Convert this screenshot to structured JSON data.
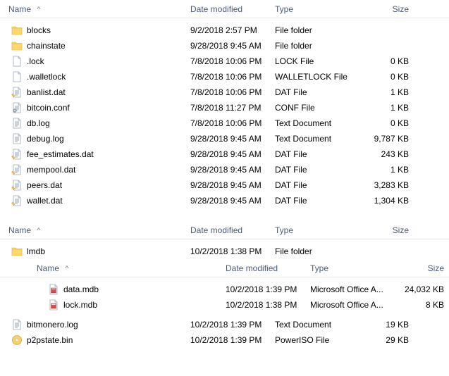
{
  "headers": {
    "name": "Name",
    "date": "Date modified",
    "type": "Type",
    "size": "Size"
  },
  "panel1": {
    "rows": [
      {
        "icon": "folder",
        "name": "blocks",
        "date": "9/2/2018 2:57 PM",
        "type": "File folder",
        "size": ""
      },
      {
        "icon": "folder",
        "name": "chainstate",
        "date": "9/28/2018 9:45 AM",
        "type": "File folder",
        "size": ""
      },
      {
        "icon": "file",
        "name": ".lock",
        "date": "7/8/2018 10:06 PM",
        "type": "LOCK File",
        "size": "0 KB"
      },
      {
        "icon": "file",
        "name": ".walletlock",
        "date": "7/8/2018 10:06 PM",
        "type": "WALLETLOCK File",
        "size": "0 KB"
      },
      {
        "icon": "dat",
        "name": "banlist.dat",
        "date": "7/8/2018 10:06 PM",
        "type": "DAT File",
        "size": "1 KB"
      },
      {
        "icon": "conf",
        "name": "bitcoin.conf",
        "date": "7/8/2018 11:27 PM",
        "type": "CONF File",
        "size": "1 KB"
      },
      {
        "icon": "text",
        "name": "db.log",
        "date": "7/8/2018 10:06 PM",
        "type": "Text Document",
        "size": "0 KB"
      },
      {
        "icon": "text",
        "name": "debug.log",
        "date": "9/28/2018 9:45 AM",
        "type": "Text Document",
        "size": "9,787 KB"
      },
      {
        "icon": "dat",
        "name": "fee_estimates.dat",
        "date": "9/28/2018 9:45 AM",
        "type": "DAT File",
        "size": "243 KB"
      },
      {
        "icon": "dat",
        "name": "mempool.dat",
        "date": "9/28/2018 9:45 AM",
        "type": "DAT File",
        "size": "1 KB"
      },
      {
        "icon": "dat",
        "name": "peers.dat",
        "date": "9/28/2018 9:45 AM",
        "type": "DAT File",
        "size": "3,283 KB"
      },
      {
        "icon": "dat",
        "name": "wallet.dat",
        "date": "9/28/2018 9:45 AM",
        "type": "DAT File",
        "size": "1,304 KB"
      }
    ]
  },
  "panel2": {
    "rows": [
      {
        "icon": "folder",
        "name": "lmdb",
        "date": "10/2/2018 1:38 PM",
        "type": "File folder",
        "size": ""
      }
    ],
    "subrows": [
      {
        "icon": "mdb",
        "name": "data.mdb",
        "date": "10/2/2018 1:39 PM",
        "type": "Microsoft Office A...",
        "size": "24,032 KB"
      },
      {
        "icon": "mdb",
        "name": "lock.mdb",
        "date": "10/2/2018 1:38 PM",
        "type": "Microsoft Office A...",
        "size": "8 KB"
      }
    ],
    "rows2": [
      {
        "icon": "text",
        "name": "bitmonero.log",
        "date": "10/2/2018 1:39 PM",
        "type": "Text Document",
        "size": "19 KB"
      },
      {
        "icon": "iso",
        "name": "p2pstate.bin",
        "date": "10/2/2018 1:39 PM",
        "type": "PowerISO File",
        "size": "29 KB"
      }
    ]
  }
}
